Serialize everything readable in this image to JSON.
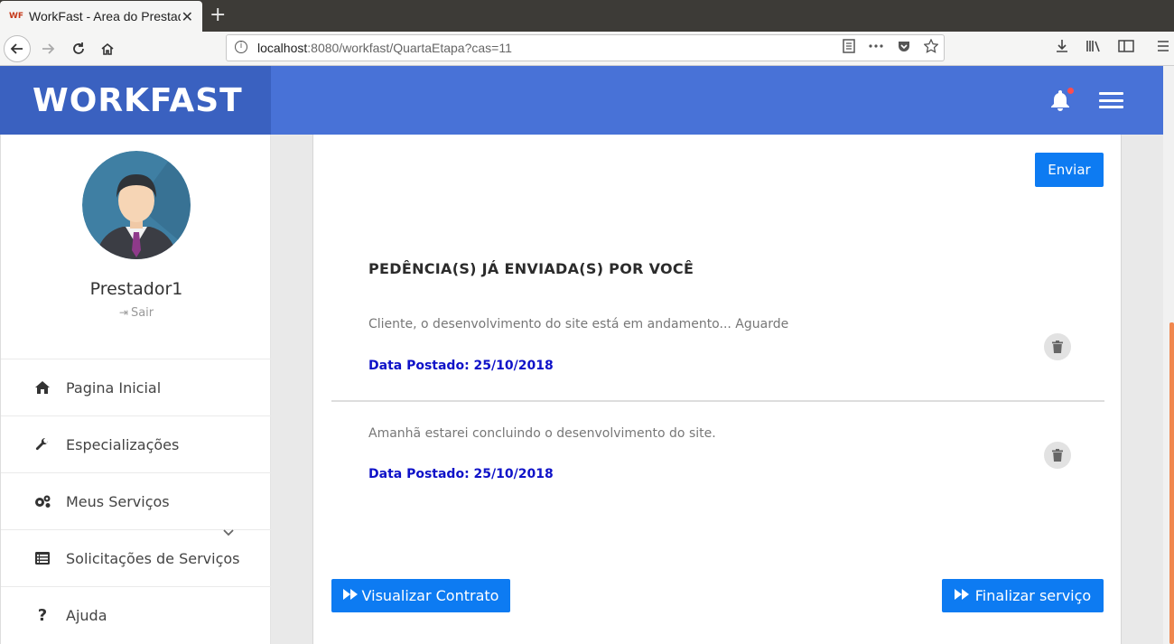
{
  "browser": {
    "tab_title": "WorkFast - Area do Prestador",
    "favicon_text": "WF",
    "close_glyph": "✕",
    "new_tab_glyph": "+",
    "url_host": "localhost",
    "url_rest": ":8080/workfast/QuartaEtapa?cas=11"
  },
  "header": {
    "brand": "WORKFAST",
    "notification_dot_color": "#ff4d4d"
  },
  "sidebar": {
    "user_name": "Prestador1",
    "logout_label": "Sair",
    "items": [
      {
        "label": "Pagina Inicial",
        "icon": "home-icon"
      },
      {
        "label": "Especializações",
        "icon": "wrench-icon"
      },
      {
        "label": "Meus Serviços",
        "icon": "cogs-icon"
      },
      {
        "label": "Solicitações de Serviços",
        "icon": "list-icon"
      },
      {
        "label": "Ajuda",
        "icon": "question-icon"
      }
    ]
  },
  "main": {
    "send_button": "Enviar",
    "section_title": "PEDÊNCIA(S) JÁ ENVIADA(S) POR VOCÊ",
    "entries": [
      {
        "message": "Cliente, o desenvolvimento do site está em andamento... Aguarde",
        "date": "Data Postado: 25/10/2018"
      },
      {
        "message": "Amanhã estarei concluindo o desenvolvimento do site.",
        "date": "Data Postado: 25/10/2018"
      }
    ],
    "view_contract_button": "Visualizar Contrato",
    "finish_service_button": "Finalizar serviço"
  },
  "colors": {
    "header_blue": "#4872d7",
    "brand_blue": "#3a61c0",
    "button_blue": "#0d7bf2",
    "date_blue": "#0f12c8"
  }
}
